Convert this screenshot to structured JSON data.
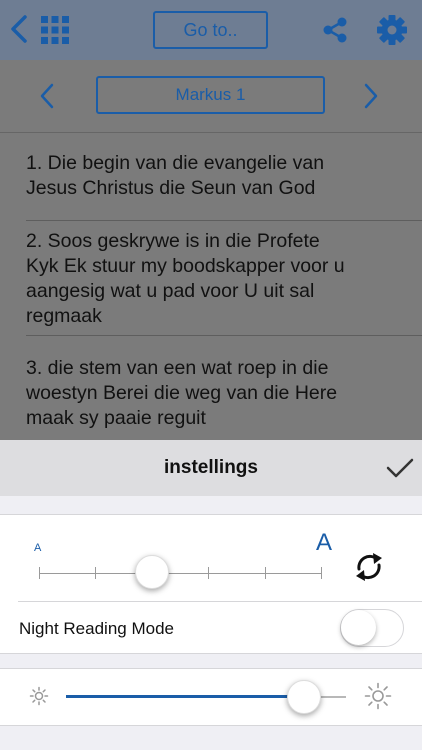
{
  "toolbar": {
    "goto_label": "Go to..",
    "back_icon": "chevron-left-icon",
    "grid_icon": "grid-icon",
    "share_icon": "share-icon",
    "settings_icon": "gear-icon"
  },
  "chapter_nav": {
    "current": "Markus 1"
  },
  "verses": [
    {
      "lines": [
        "1. Die begin van die evangelie van",
        "Jesus Christus  die Seun van God"
      ]
    },
    {
      "lines": [
        "2. Soos geskrywe is in die Profete",
        "Kyk  Ek stuur my boodskapper voor u",
        "aangesig  wat u pad voor U uit sal",
        "regmaak"
      ]
    },
    {
      "lines": [
        "3. die stem van een wat roep in die",
        "woestyn  Berei die weg van die Here",
        "maak sy paaie reguit"
      ]
    }
  ],
  "settings": {
    "title": "instellings",
    "font_small_label": "A",
    "font_large_label": "A",
    "font_size_level": 0.4,
    "night_mode_label": "Night Reading Mode",
    "night_mode_on": false,
    "brightness_level": 0.85
  },
  "colors": {
    "accent": "#1a5da8"
  }
}
